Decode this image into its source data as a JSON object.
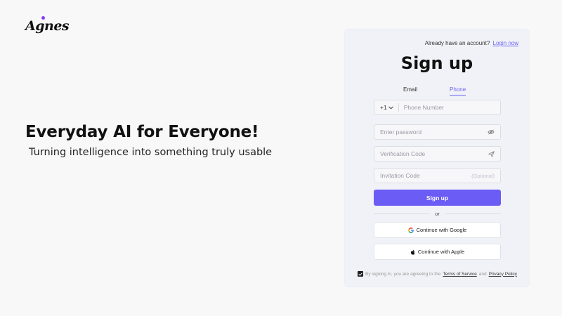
{
  "brand": {
    "logo_text": "Agnes"
  },
  "hero": {
    "title": "Everyday AI for Everyone!",
    "subtitle": "Turning intelligence into something truly usable"
  },
  "signup": {
    "already_text": "Already have an account?",
    "login_link": "Login now",
    "title": "Sign up",
    "tabs": [
      {
        "label": "Email",
        "active": false
      },
      {
        "label": "Phone",
        "active": true
      }
    ],
    "country_code": "+1",
    "phone_placeholder": "Phone Number",
    "password_placeholder": "Enter password",
    "verification_placeholder": "Verification Code",
    "invitation_placeholder": "Invitation Code",
    "invitation_optional": "(Optional)",
    "submit_label": "Sign up",
    "or_label": "or",
    "google_label": "Continue with Google",
    "apple_label": "Continue with Apple",
    "terms_prefix": "By signing in, you are agreeing to the",
    "terms_link": "Terms of Service",
    "terms_and": "and",
    "privacy_link": "Privacy Policy",
    "terms_checked": true
  },
  "colors": {
    "accent": "#6b5cf6",
    "logo_dot": "#8a3cf5",
    "card_bg": "#f1f2f7",
    "page_bg": "#f8f8f9"
  },
  "icons": [
    "eye-off-icon",
    "send-icon",
    "google-icon",
    "apple-icon",
    "chevron-down-icon",
    "check-icon"
  ]
}
